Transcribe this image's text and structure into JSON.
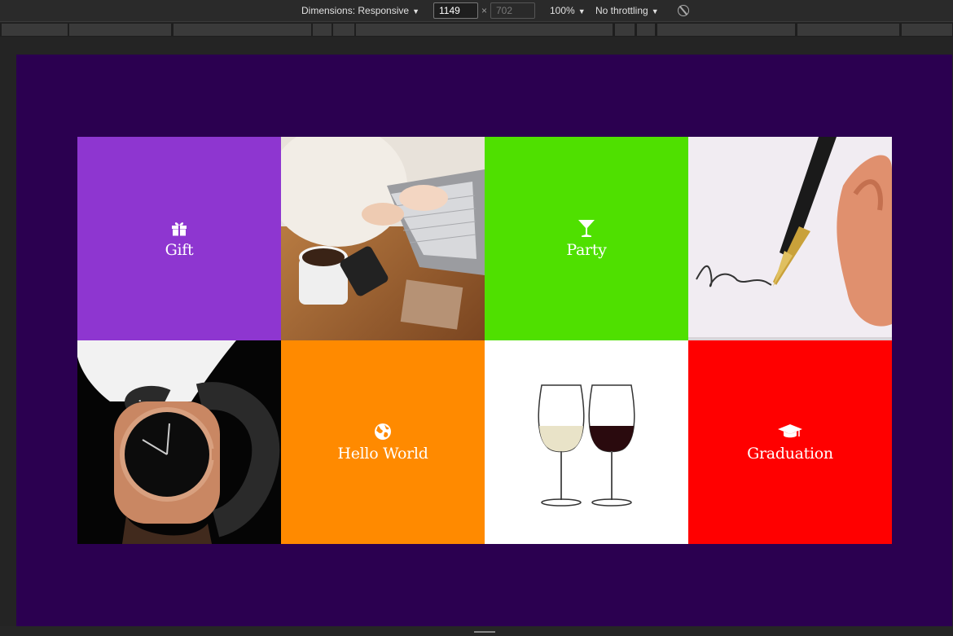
{
  "devtools": {
    "dimensions_label": "Dimensions: Responsive",
    "width_value": "1149",
    "height_placeholder": "702",
    "times": "×",
    "zoom": "100%",
    "throttling": "No throttling"
  },
  "tiles": [
    {
      "kind": "text",
      "label": "Gift",
      "icon": "gift-icon",
      "color": "#8e36d0"
    },
    {
      "kind": "image",
      "subject": "laptop-coffee-desk"
    },
    {
      "kind": "text",
      "label": "Party",
      "icon": "cocktail-icon",
      "color": "#4fe000"
    },
    {
      "kind": "image",
      "subject": "fountain-pen-signature"
    },
    {
      "kind": "image",
      "subject": "wrist-watch"
    },
    {
      "kind": "text",
      "label": "Hello World",
      "icon": "globe-icon",
      "color": "#ff8a00"
    },
    {
      "kind": "image",
      "subject": "wine-glasses"
    },
    {
      "kind": "text",
      "label": "Graduation",
      "icon": "graduation-cap-icon",
      "color": "#ff0000"
    }
  ],
  "colors": {
    "viewport_bg": "#2b0050",
    "devtools_bg": "#2a2a2a"
  }
}
